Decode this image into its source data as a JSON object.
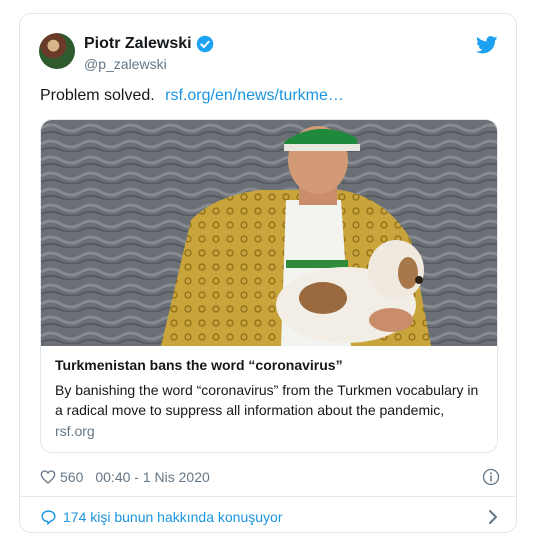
{
  "tweet": {
    "author_name": "Piotr Zalewski",
    "author_handle": "@p_zalewski",
    "text": "Problem solved.",
    "link_text": "rsf.org/en/news/turkme…",
    "likes": "560",
    "timestamp": "00:40 - 1 Nis 2020",
    "conversation": "174 kişi bunun hakkında konuşuyor"
  },
  "card": {
    "title": "Turkmenistan bans the word “coronavirus”",
    "description": "By banishing the word “coronavirus” from the Turkmen vocabulary in a radical move to suppress all information about the pandemic,",
    "domain": "rsf.org"
  },
  "icons": {
    "verified": "verified-badge-icon",
    "brand": "twitter-bird-icon",
    "like": "heart-icon",
    "info": "info-icon",
    "reply": "comment-icon",
    "more": "chevron-right-icon"
  },
  "colors": {
    "link": "#1b95e0",
    "muted": "#657786",
    "text": "#14171a",
    "border": "#e1e8ed"
  }
}
